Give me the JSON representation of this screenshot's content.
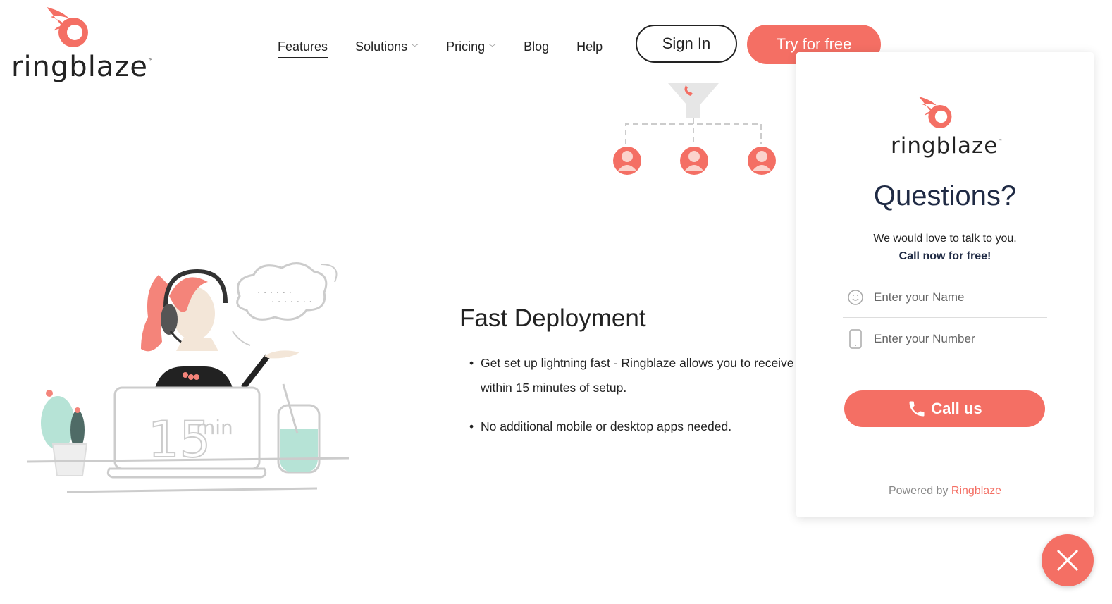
{
  "brand": {
    "name": "ringblaze",
    "tm": "™",
    "accent": "#f46f64"
  },
  "nav": {
    "items": [
      {
        "label": "Features",
        "active": true,
        "dropdown": false
      },
      {
        "label": "Solutions",
        "active": false,
        "dropdown": true
      },
      {
        "label": "Pricing",
        "active": false,
        "dropdown": true
      },
      {
        "label": "Blog",
        "active": false,
        "dropdown": false
      },
      {
        "label": "Help",
        "active": false,
        "dropdown": false
      }
    ],
    "sign_in": "Sign In",
    "try_free": "Try for free"
  },
  "feature": {
    "title": "Fast Deployment",
    "bullets": [
      "Get set up lightning fast - Ringblaze allows you to receive y",
      "within 15 minutes of setup.",
      "No additional mobile or desktop apps needed."
    ]
  },
  "illustration": {
    "laptop_text_big": "15",
    "laptop_text_small": "min"
  },
  "widget": {
    "title": "Questions?",
    "subtitle": "We would love to talk to you.",
    "subtitle_bold": "Call now for free!",
    "name_placeholder": "Enter your Name",
    "number_placeholder": "Enter your Number",
    "call_button": "Call us",
    "powered_by": "Powered by ",
    "powered_link": "Ringblaze"
  }
}
